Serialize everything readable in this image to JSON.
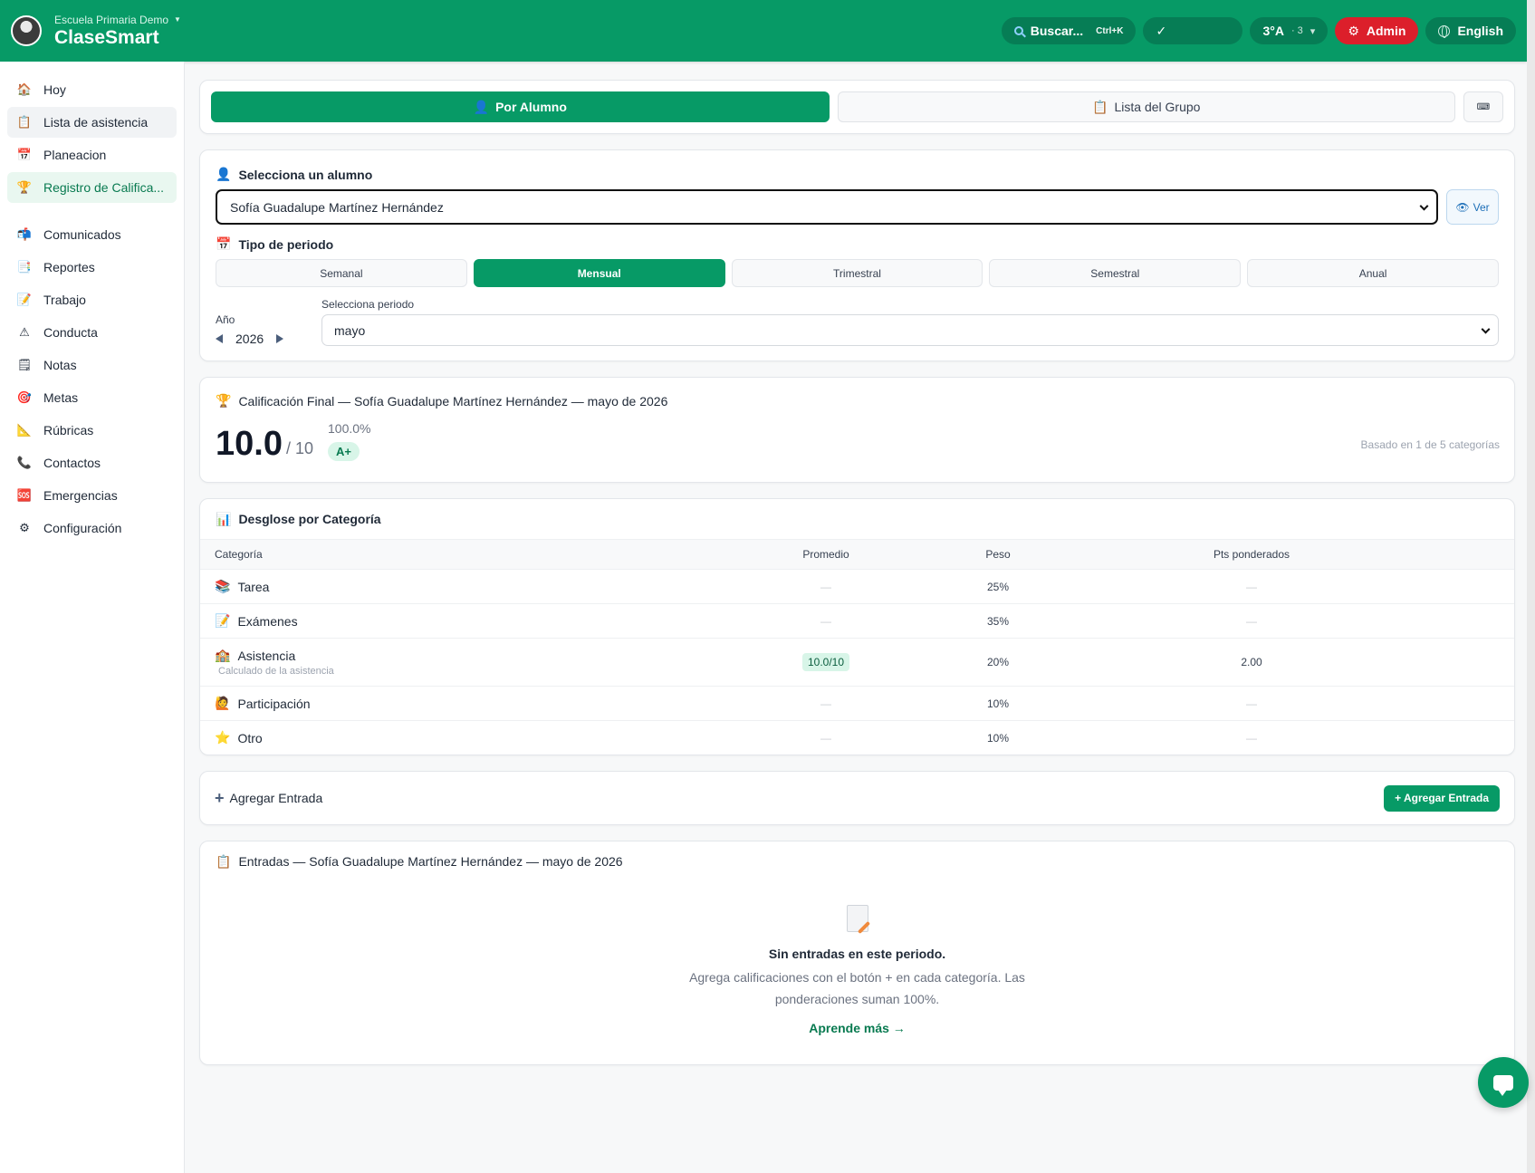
{
  "header": {
    "school": "Escuela Primaria Demo",
    "app_name": "ClaseSmart",
    "search_label": "Buscar...",
    "search_shortcut": "Ctrl+K",
    "check_mark": "✓",
    "group_label": "3°A",
    "group_count": "· 3",
    "admin_label": "Admin",
    "language_label": "English",
    "brand_color": "#079a66"
  },
  "sidebar": {
    "items": [
      {
        "label": "Hoy",
        "icon": "house-icon"
      },
      {
        "label": "Lista de asistencia",
        "icon": "clipboard-icon"
      },
      {
        "label": "Planeacion",
        "icon": "calendar-icon"
      },
      {
        "label": "Registro de Califica...",
        "icon": "trophy-icon"
      },
      {
        "label": "Comunicados",
        "icon": "mailbox-icon"
      },
      {
        "label": "Reportes",
        "icon": "report-icon"
      },
      {
        "label": "Trabajo",
        "icon": "pencil-paper-icon"
      },
      {
        "label": "Conducta",
        "icon": "warning-icon"
      },
      {
        "label": "Notas",
        "icon": "note-icon"
      },
      {
        "label": "Metas",
        "icon": "target-icon"
      },
      {
        "label": "Rúbricas",
        "icon": "ruler-icon"
      },
      {
        "label": "Contactos",
        "icon": "phone-icon"
      },
      {
        "label": "Emergencias",
        "icon": "sos-icon"
      },
      {
        "label": "Configuración",
        "icon": "gear-icon"
      }
    ]
  },
  "mode": {
    "by_student": "Por Alumno",
    "group_list": "Lista del Grupo"
  },
  "selector": {
    "student_label": "Selecciona un alumno",
    "student_value": "Sofía Guadalupe Martínez Hernández",
    "view_label": "Ver",
    "period_type_label": "Tipo de periodo",
    "period_types": [
      "Semanal",
      "Mensual",
      "Trimestral",
      "Semestral",
      "Anual"
    ],
    "period_type_selected": "Mensual",
    "year_label": "Año",
    "year": "2026",
    "period_label": "Selecciona periodo",
    "period_value": "mayo"
  },
  "final": {
    "title": "Calificación Final — Sofía Guadalupe Martínez Hernández — mayo de 2026",
    "score": "10.0",
    "score_of": "/ 10",
    "percent": "100.0%",
    "grade": "A+",
    "based_on": "Basado en 1 de 5 categorías"
  },
  "breakdown": {
    "title": "Desglose por Categoría",
    "columns": [
      "Categoría",
      "Promedio",
      "Peso",
      "Pts ponderados"
    ],
    "rows": [
      {
        "category": "Tarea",
        "icon": "books-icon",
        "average": "—",
        "weight": "25%",
        "points": "—"
      },
      {
        "category": "Exámenes",
        "icon": "memo-icon",
        "average": "—",
        "weight": "35%",
        "points": "—"
      },
      {
        "category": "Asistencia",
        "icon": "school-icon",
        "subtitle": "Calculado de la asistencia",
        "average": "10.0/10",
        "weight": "20%",
        "points": "2.00"
      },
      {
        "category": "Participación",
        "icon": "raised-hand-icon",
        "average": "—",
        "weight": "10%",
        "points": "—"
      },
      {
        "category": "Otro",
        "icon": "star-icon",
        "average": "—",
        "weight": "10%",
        "points": "—"
      }
    ]
  },
  "add_entry": {
    "title": "Agregar Entrada",
    "button": "+ Agregar Entrada"
  },
  "entries": {
    "title": "Entradas — Sofía Guadalupe Martínez Hernández — mayo de 2026",
    "empty_title": "Sin entradas en este periodo.",
    "empty_text": "Agrega calificaciones con el botón + en cada categoría. Las ponderaciones suman 100%.",
    "learn_more": "Aprende más →"
  }
}
